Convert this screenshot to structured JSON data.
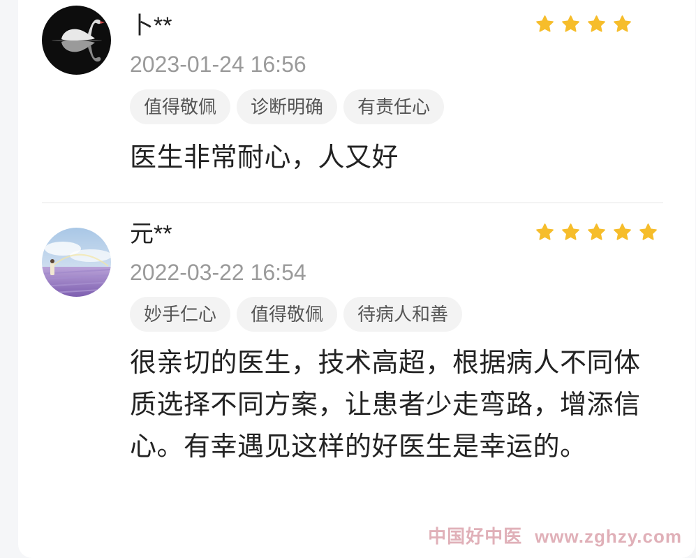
{
  "colors": {
    "star": "#f6bd2b",
    "tag_bg": "#f3f3f3",
    "tag_text": "#555555",
    "date": "#9a9a9a",
    "watermark": "#d696a0"
  },
  "reviews": [
    {
      "username": "卜**",
      "date": "2023-01-24 16:56",
      "rating": 4,
      "avatar_icon": "swan-avatar",
      "tags": [
        "值得敬佩",
        "诊断明确",
        "有责任心"
      ],
      "comment": "医生非常耐心，人又好"
    },
    {
      "username": "元**",
      "date": "2022-03-22 16:54",
      "rating": 5,
      "avatar_icon": "lavender-field-avatar",
      "tags": [
        "妙手仁心",
        "值得敬佩",
        "待病人和善"
      ],
      "comment": "很亲切的医生，技术高超，根据病人不同体质选择不同方案，让患者少走弯路，增添信心。有幸遇见这样的好医生是幸运的。"
    }
  ],
  "watermark": {
    "cn": "中国好中医",
    "url": "www.zghzy.com"
  }
}
